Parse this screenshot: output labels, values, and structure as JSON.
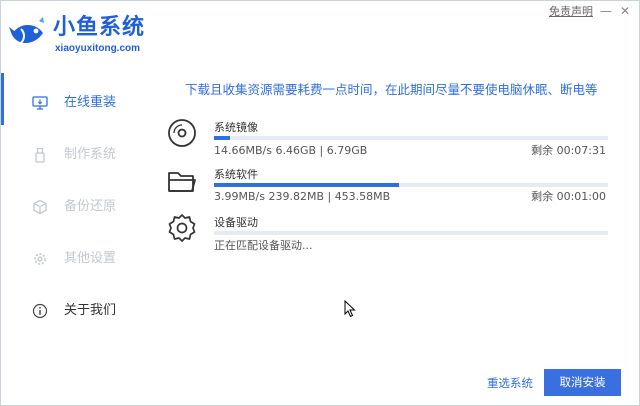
{
  "header": {
    "logo_title": "小鱼系统",
    "logo_subtitle": "xiaoyuxitong.com",
    "disclaimer": "免责声明",
    "minimize_glyph": "—",
    "close_glyph": "✕"
  },
  "sidebar": {
    "items": [
      {
        "label": "在线重装",
        "icon": "monitor-icon",
        "state": "active"
      },
      {
        "label": "制作系统",
        "icon": "usb-icon",
        "state": "disabled"
      },
      {
        "label": "备份还原",
        "icon": "cube-icon",
        "state": "disabled"
      },
      {
        "label": "其他设置",
        "icon": "gear-icon",
        "state": "disabled"
      },
      {
        "label": "关于我们",
        "icon": "info-icon",
        "state": "normal"
      }
    ]
  },
  "main": {
    "notice": "下载且收集资源需要耗费一点时间，在此期间尽量不要使电脑休眠、断电等",
    "tasks": [
      {
        "name": "系统镜像",
        "icon": "disc-icon",
        "detail": "14.66MB/s 6.46GB | 6.79GB",
        "remaining": "剩余 00:07:31",
        "progress": 0.04
      },
      {
        "name": "系统软件",
        "icon": "folder-icon",
        "detail": "3.99MB/s 239.82MB | 453.58MB",
        "remaining": "剩余 00:01:00",
        "progress": 0.47
      },
      {
        "name": "设备驱动",
        "icon": "settings-icon",
        "detail": "正在匹配设备驱动...",
        "remaining": "",
        "progress": 0
      }
    ]
  },
  "footer": {
    "reselect_label": "重选系统",
    "cancel_label": "取消安装"
  },
  "colors": {
    "accent": "#2f6fe0",
    "disabled": "#c3c8cf"
  }
}
